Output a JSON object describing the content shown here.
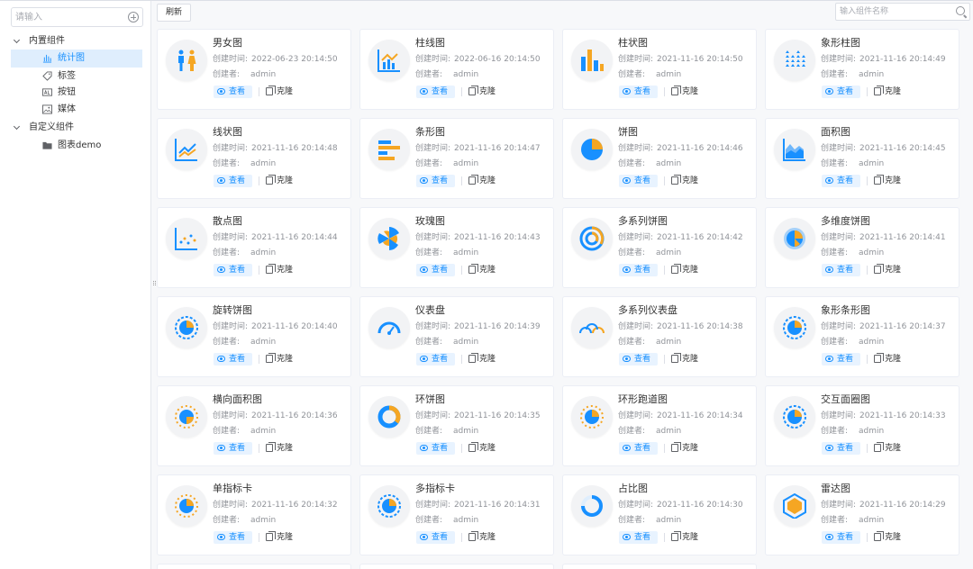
{
  "sidebar": {
    "search_placeholder": "请输入",
    "groups": [
      {
        "label": "内置组件",
        "items": [
          {
            "label": "统计图",
            "icon": "bar-chart-icon",
            "active": true
          },
          {
            "label": "标签",
            "icon": "tag-icon"
          },
          {
            "label": "按钮",
            "icon": "button-icon"
          },
          {
            "label": "媒体",
            "icon": "image-icon"
          }
        ]
      },
      {
        "label": "自定义组件",
        "items": [
          {
            "label": "图表demo",
            "icon": "folder-icon"
          }
        ]
      }
    ]
  },
  "toolbar": {
    "refresh_label": "刷新",
    "search_placeholder": "输入组件名称"
  },
  "card_labels": {
    "time": "创建时间:",
    "author": "创建者:",
    "view": "查看",
    "clone": "克隆"
  },
  "colors": {
    "accent": "#1890ff",
    "orange": "#f5a623",
    "icon_bg": "#f2f3f5"
  },
  "cards": [
    {
      "title": "男女图",
      "time": "2022-06-23 20:14:50",
      "author": "admin",
      "icon": "gender-chart-icon"
    },
    {
      "title": "柱线图",
      "time": "2022-06-16 20:14:50",
      "author": "admin",
      "icon": "bar-line-chart-icon"
    },
    {
      "title": "柱状图",
      "time": "2021-11-16 20:14:50",
      "author": "admin",
      "icon": "bar-chart-icon"
    },
    {
      "title": "象形柱图",
      "time": "2021-11-16 20:14:49",
      "author": "admin",
      "icon": "pictorial-bar-icon"
    },
    {
      "title": "线状图",
      "time": "2021-11-16 20:14:48",
      "author": "admin",
      "icon": "line-chart-icon"
    },
    {
      "title": "条形图",
      "time": "2021-11-16 20:14:47",
      "author": "admin",
      "icon": "horizontal-bar-icon"
    },
    {
      "title": "饼图",
      "time": "2021-11-16 20:14:46",
      "author": "admin",
      "icon": "pie-chart-icon"
    },
    {
      "title": "面积图",
      "time": "2021-11-16 20:14:45",
      "author": "admin",
      "icon": "area-chart-icon"
    },
    {
      "title": "散点图",
      "time": "2021-11-16 20:14:44",
      "author": "admin",
      "icon": "scatter-chart-icon"
    },
    {
      "title": "玫瑰图",
      "time": "2021-11-16 20:14:43",
      "author": "admin",
      "icon": "rose-chart-icon"
    },
    {
      "title": "多系列饼图",
      "time": "2021-11-16 20:14:42",
      "author": "admin",
      "icon": "multi-pie-icon"
    },
    {
      "title": "多维度饼图",
      "time": "2021-11-16 20:14:41",
      "author": "admin",
      "icon": "multi-dim-pie-icon"
    },
    {
      "title": "旋转饼图",
      "time": "2021-11-16 20:14:40",
      "author": "admin",
      "icon": "rotating-pie-icon"
    },
    {
      "title": "仪表盘",
      "time": "2021-11-16 20:14:39",
      "author": "admin",
      "icon": "gauge-icon"
    },
    {
      "title": "多系列仪表盘",
      "time": "2021-11-16 20:14:38",
      "author": "admin",
      "icon": "multi-gauge-icon"
    },
    {
      "title": "象形条形图",
      "time": "2021-11-16 20:14:37",
      "author": "admin",
      "icon": "pictorial-strip-icon"
    },
    {
      "title": "横向面积图",
      "time": "2021-11-16 20:14:36",
      "author": "admin",
      "icon": "horizontal-area-icon"
    },
    {
      "title": "环饼图",
      "time": "2021-11-16 20:14:35",
      "author": "admin",
      "icon": "ring-pie-icon"
    },
    {
      "title": "环形跑道图",
      "time": "2021-11-16 20:14:34",
      "author": "admin",
      "icon": "ring-track-icon"
    },
    {
      "title": "交互面圈图",
      "time": "2021-11-16 20:14:33",
      "author": "admin",
      "icon": "interactive-ring-icon"
    },
    {
      "title": "单指标卡",
      "time": "2021-11-16 20:14:32",
      "author": "admin",
      "icon": "single-kpi-icon"
    },
    {
      "title": "多指标卡",
      "time": "2021-11-16 20:14:31",
      "author": "admin",
      "icon": "multi-kpi-icon"
    },
    {
      "title": "占比图",
      "time": "2021-11-16 20:14:30",
      "author": "admin",
      "icon": "ratio-chart-icon"
    },
    {
      "title": "雷达图",
      "time": "2021-11-16 20:14:29",
      "author": "admin",
      "icon": "radar-chart-icon"
    }
  ]
}
